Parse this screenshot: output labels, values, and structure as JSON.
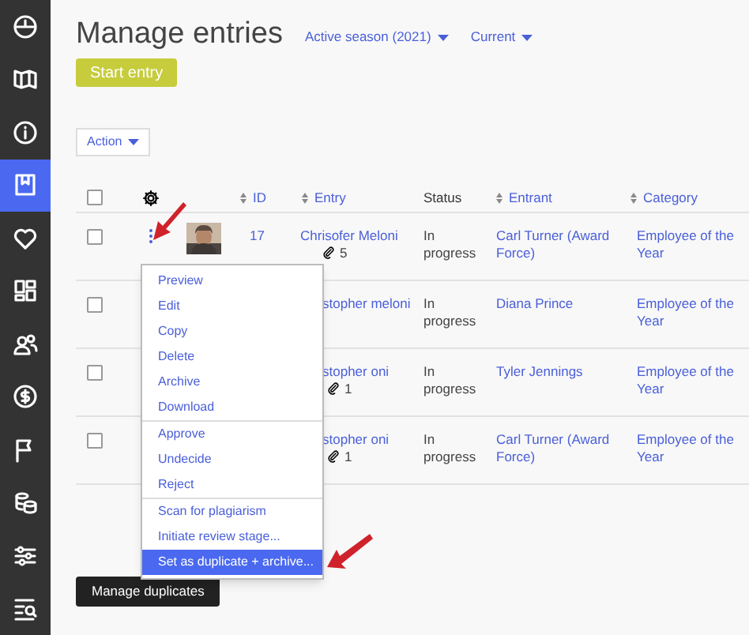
{
  "sidebar": {
    "items": [
      {
        "selected": false
      },
      {
        "selected": false
      },
      {
        "selected": false
      },
      {
        "selected": true
      },
      {
        "selected": false
      },
      {
        "selected": false
      },
      {
        "selected": false
      },
      {
        "selected": false
      },
      {
        "selected": false
      },
      {
        "selected": false
      },
      {
        "selected": false
      },
      {
        "selected": false
      }
    ]
  },
  "header": {
    "title": "Manage entries",
    "filters": [
      "Active season (2021)",
      "Current"
    ]
  },
  "start_button": "Start entry",
  "action_dropdown": "Action",
  "table": {
    "select_all_checked": false,
    "columns": [
      {
        "label": "ID",
        "sortable": true
      },
      {
        "label": "Entry",
        "sortable": true
      },
      {
        "label": "Status",
        "sortable": false
      },
      {
        "label": "Entrant",
        "sortable": true
      },
      {
        "label": "Category",
        "sortable": true
      }
    ],
    "rows": [
      {
        "id": "17",
        "entry": "Chrisofer Meloni",
        "attachments": "5",
        "status": "In progress",
        "entrant": "Carl Turner (Award Force)",
        "category": "Employee of the Year",
        "thumbnail": true,
        "clipped": false,
        "checked": false
      },
      {
        "entry": "stopher meloni",
        "status": "In progress",
        "entrant": "Diana Prince",
        "category": "Employee of the Year",
        "thumbnail": false,
        "clipped": true,
        "checked": false
      },
      {
        "entry": "stopher oni",
        "attachments": "1",
        "status": "In progress",
        "entrant": "Tyler Jennings",
        "category": "Employee of the Year",
        "thumbnail": false,
        "clipped": true,
        "checked": false
      },
      {
        "entry": "stopher oni",
        "attachments": "1",
        "status": "In progress",
        "entrant": "Carl Turner (Award Force)",
        "category": "Employee of the Year",
        "thumbnail": false,
        "clipped": true,
        "checked": false
      }
    ]
  },
  "context_menu": {
    "groups": [
      [
        {
          "label": "Preview",
          "selected": false
        },
        {
          "label": "Edit",
          "selected": false
        },
        {
          "label": "Copy",
          "selected": false
        },
        {
          "label": "Delete",
          "selected": false
        },
        {
          "label": "Archive",
          "selected": false
        },
        {
          "label": "Download",
          "selected": false
        }
      ],
      [
        {
          "label": "Approve",
          "selected": false
        },
        {
          "label": "Undecide",
          "selected": false
        },
        {
          "label": "Reject",
          "selected": false
        }
      ],
      [
        {
          "label": "Scan for plagiarism",
          "selected": false
        },
        {
          "label": "Initiate review stage...",
          "selected": false
        },
        {
          "label": "Set as duplicate + archive...",
          "selected": true
        }
      ]
    ]
  },
  "manage_duplicates_button": "Manage duplicates"
}
